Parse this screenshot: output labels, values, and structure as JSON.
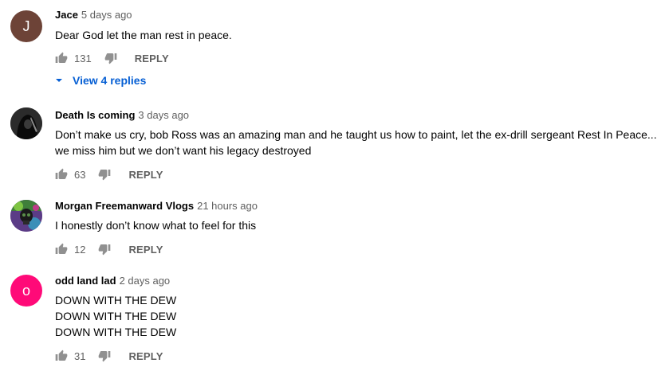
{
  "comments": [
    {
      "author": "Jace",
      "time": "5 days ago",
      "avatar_letter": "J",
      "avatar_color": "#6d4337",
      "lines": [
        "Dear God let the man rest in peace."
      ],
      "likes": "131",
      "reply_label": "REPLY",
      "view_replies": "View 4 replies"
    },
    {
      "author": "Death Is coming",
      "time": "3 days ago",
      "lines": [
        "Don’t make us cry, bob Ross was an amazing man and he taught us how to paint, let the ex-drill sergeant Rest In Peace...",
        "we miss him but we don’t want his legacy destroyed"
      ],
      "likes": "63",
      "reply_label": "REPLY"
    },
    {
      "author": "Morgan Freemanward Vlogs",
      "time": "21 hours ago",
      "lines": [
        "I honestly don’t know what to feel for this"
      ],
      "likes": "12",
      "reply_label": "REPLY"
    },
    {
      "author": "odd land lad",
      "time": "2 days ago",
      "avatar_letter": "o",
      "avatar_color": "#ff0a78",
      "lines": [
        "DOWN WITH THE DEW",
        "DOWN WITH THE DEW",
        "DOWN WITH THE DEW"
      ],
      "likes": "31",
      "reply_label": "REPLY"
    }
  ],
  "colors": {
    "link_blue": "#065fd4",
    "secondary_text": "#606060"
  },
  "icons": {
    "like": "thumb-up-icon",
    "dislike": "thumb-down-icon",
    "expand": "caret-down-icon"
  }
}
